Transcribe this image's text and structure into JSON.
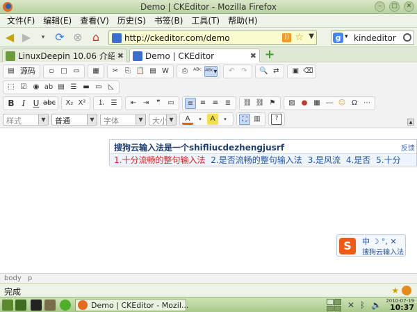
{
  "window": {
    "title": "Demo | CKEditor - Mozilla Firefox"
  },
  "menu": [
    {
      "label": "文件(F)"
    },
    {
      "label": "编辑(E)"
    },
    {
      "label": "查看(V)"
    },
    {
      "label": "历史(S)"
    },
    {
      "label": "书签(B)"
    },
    {
      "label": "工具(T)"
    },
    {
      "label": "帮助(H)"
    }
  ],
  "nav": {
    "url": "http://ckeditor.com/demo",
    "search_value": "kindeditor",
    "search_engine_glyph": "g"
  },
  "tabs": [
    {
      "label": "LinuxDeepin 10.06 介绍 | L...",
      "active": false
    },
    {
      "label": "Demo | CKEditor",
      "active": true
    }
  ],
  "toolbar": {
    "source_label": "源码",
    "bold": "B",
    "italic": "I",
    "underline": "U",
    "strike": "abc",
    "subscript": "X₂",
    "superscript": "X²",
    "styles_combo": "样式",
    "format_combo": "普通",
    "font_combo": "字体",
    "size_combo": "大小",
    "text_color_label": "A",
    "bg_color_label": "A",
    "help_label": "?"
  },
  "ime": {
    "input": "搜狗云输入法是一个shifliucdezhengjusrf",
    "feedback": "反馈",
    "first_candidate": "1.十分流畅的整句输入法",
    "candidates": [
      "2.是否流畅的整句输入法",
      "3.是风流",
      "4.是否",
      "5.十分"
    ]
  },
  "sogou": {
    "logo": "S",
    "controls": "中 ☽ °, ✕",
    "name": "搜狗云输入法"
  },
  "editor_path": [
    "body",
    "p"
  ],
  "status": {
    "text": "完成"
  },
  "taskbar": {
    "task_title": "Demo | CKEditor - Mozil...",
    "date": "2010-07-19",
    "time": "10:37"
  },
  "colors": {
    "titlebar": "#b9d19f",
    "chrome": "#eef3e8",
    "ime_candidate_first": "#d11f1f",
    "ime_candidate": "#1f53a8",
    "sogou_brand": "#f25a13"
  }
}
